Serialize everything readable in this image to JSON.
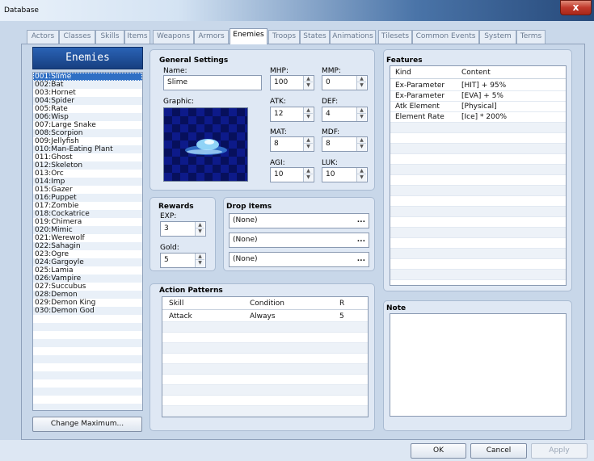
{
  "window": {
    "title": "Database",
    "close_glyph": "x"
  },
  "tabs": [
    "Actors",
    "Classes",
    "Skills",
    "Items",
    "Weapons",
    "Armors",
    "Enemies",
    "Troops",
    "States",
    "Animations",
    "Tilesets",
    "Common Events",
    "System",
    "Terms"
  ],
  "active_tab": "Enemies",
  "enemy_list": {
    "header": "Enemies",
    "items": [
      "001:Slime",
      "002:Bat",
      "003:Hornet",
      "004:Spider",
      "005:Rate",
      "006:Wisp",
      "007:Large Snake",
      "008:Scorpion",
      "009:Jellyfish",
      "010:Man-Eating Plant",
      "011:Ghost",
      "012:Skeleton",
      "013:Orc",
      "014:Imp",
      "015:Gazer",
      "016:Puppet",
      "017:Zombie",
      "018:Cockatrice",
      "019:Chimera",
      "020:Mimic",
      "021:Werewolf",
      "022:Sahagin",
      "023:Ogre",
      "024:Gargoyle",
      "025:Lamia",
      "026:Vampire",
      "027:Succubus",
      "028:Demon",
      "029:Demon King",
      "030:Demon God"
    ],
    "selected": "001:Slime",
    "change_max_label": "Change Maximum..."
  },
  "general": {
    "title": "General Settings",
    "name_label": "Name:",
    "name_value": "Slime",
    "graphic_label": "Graphic:",
    "params": {
      "mhp": {
        "label": "MHP:",
        "value": "100"
      },
      "mmp": {
        "label": "MMP:",
        "value": "0"
      },
      "atk": {
        "label": "ATK:",
        "value": "12"
      },
      "def": {
        "label": "DEF:",
        "value": "4"
      },
      "mat": {
        "label": "MAT:",
        "value": "8"
      },
      "mdf": {
        "label": "MDF:",
        "value": "8"
      },
      "agi": {
        "label": "AGI:",
        "value": "10"
      },
      "luk": {
        "label": "LUK:",
        "value": "10"
      }
    }
  },
  "rewards": {
    "title": "Rewards",
    "exp_label": "EXP:",
    "exp_value": "3",
    "gold_label": "Gold:",
    "gold_value": "5"
  },
  "drop_items": {
    "title": "Drop Items",
    "items": [
      "(None)",
      "(None)",
      "(None)"
    ],
    "browse_glyph": "..."
  },
  "action_patterns": {
    "title": "Action Patterns",
    "columns": [
      "Skill",
      "Condition",
      "R"
    ],
    "rows": [
      {
        "skill": "Attack",
        "condition": "Always",
        "r": "5"
      }
    ]
  },
  "features": {
    "title": "Features",
    "columns": [
      "Kind",
      "Content"
    ],
    "rows": [
      {
        "kind": "Ex-Parameter",
        "content": "[HIT] + 95%"
      },
      {
        "kind": "Ex-Parameter",
        "content": "[EVA] + 5%"
      },
      {
        "kind": "Atk Element",
        "content": "[Physical]"
      },
      {
        "kind": "Element Rate",
        "content": "[Ice] * 200%"
      }
    ]
  },
  "note": {
    "title": "Note",
    "value": ""
  },
  "buttons": {
    "ok": "OK",
    "cancel": "Cancel",
    "apply": "Apply"
  }
}
